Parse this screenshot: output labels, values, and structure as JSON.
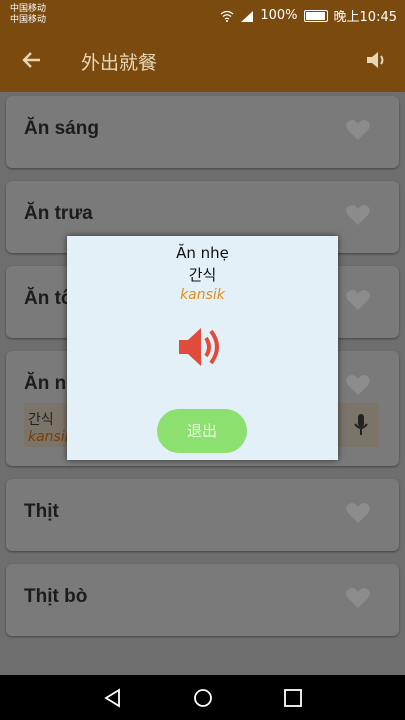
{
  "status": {
    "carrier1": "中国移动",
    "carrier2": "中国移动",
    "battery": "100%",
    "time": "晚上10:45"
  },
  "appbar": {
    "title": "外出就餐",
    "back_icon": "arrow-left-icon",
    "sound_icon": "volume-icon"
  },
  "items": [
    {
      "label": "Ăn sáng"
    },
    {
      "label": "Ăn trưa"
    },
    {
      "label": "Ăn tối"
    },
    {
      "label": "Ăn nhẹ",
      "korean": "간식",
      "roman": "kansik"
    },
    {
      "label": "Thịt"
    },
    {
      "label": "Thịt bò"
    }
  ],
  "dialog": {
    "title": "Ăn nhẹ",
    "korean": "간식",
    "roman": "kansik",
    "exit_label": "退出",
    "accent": "#e2901b",
    "speaker_color": "#e04b3c"
  },
  "colors": {
    "appbar": "#7a4a0f",
    "exit_button": "#8be06f"
  }
}
